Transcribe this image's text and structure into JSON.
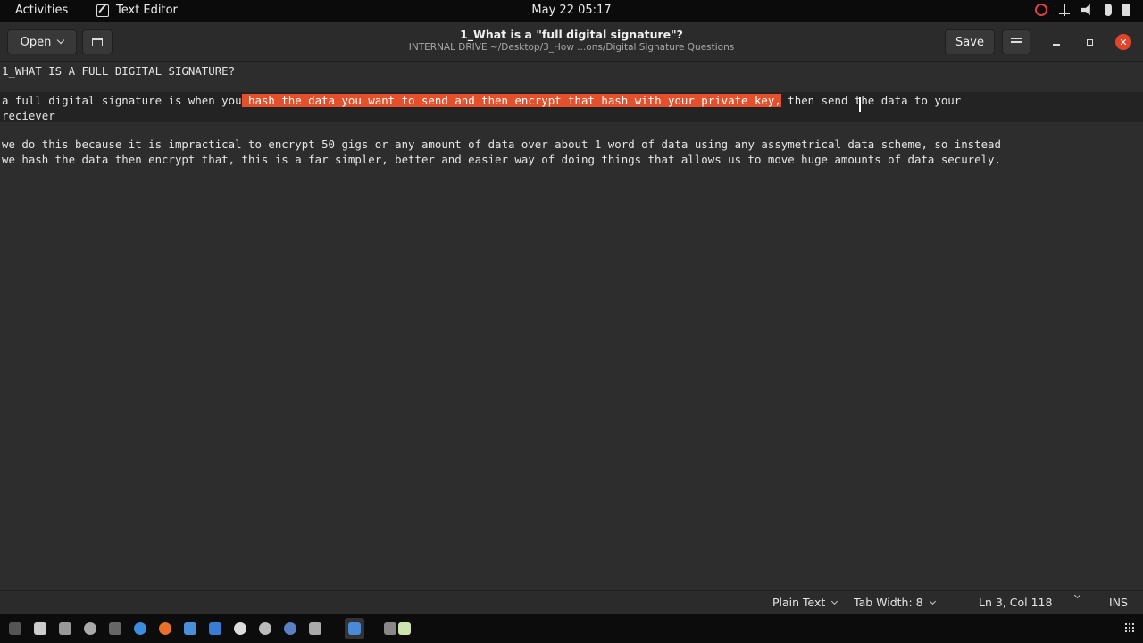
{
  "topbar": {
    "activities": "Activities",
    "app_name": "Text Editor",
    "datetime": "May 22  05:17"
  },
  "header": {
    "open_label": "Open",
    "title": "1_What is a \"full digital signature\"?",
    "path": "INTERNAL DRIVE ~/Desktop/3_How ...ons/Digital Signature Questions",
    "save_label": "Save"
  },
  "editor": {
    "line1": "1_WHAT IS A FULL DIGITAL SIGNATURE?",
    "line3_pre": "a full digital signature is when you",
    "line3_sel": " hash the data you want to send and then encrypt that hash with your private key,",
    "line3_post": " then send the data to your",
    "line3_wrap": "reciever",
    "line5a": "we do this because it is impractical to encrypt 50 gigs or any amount of data over about 1 word of data using any assymetrical data scheme, so instead",
    "line5b": "we hash the data then encrypt that, this is a far simpler, better and easier way of doing things that allows us to move huge amounts of data securely."
  },
  "status": {
    "language": "Plain Text",
    "tab_width": "Tab Width: 8",
    "position": "Ln 3, Col 118",
    "mode": "INS"
  },
  "colors": {
    "selection": "#e4502b",
    "close_button": "#e0452a"
  }
}
